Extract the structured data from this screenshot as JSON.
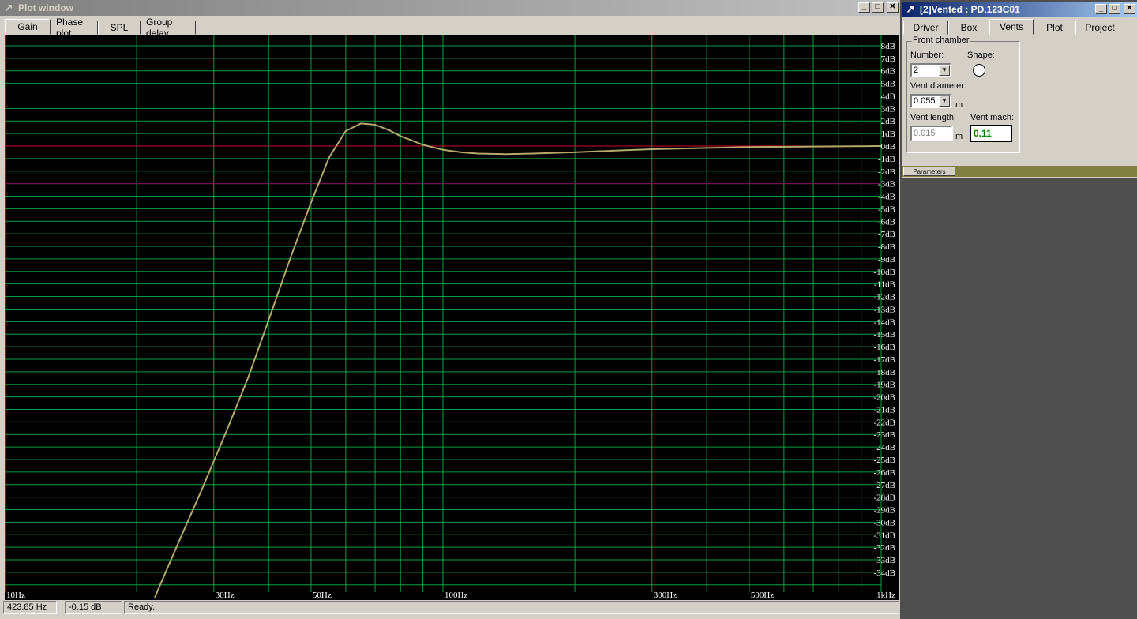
{
  "plot_window": {
    "title": "Plot window",
    "tabs": [
      {
        "label": "Gain",
        "active": true
      },
      {
        "label": "Phase plot",
        "active": false
      },
      {
        "label": "SPL",
        "active": false
      },
      {
        "label": "Group delay",
        "active": false
      }
    ]
  },
  "status": {
    "frequency": "423.85 Hz",
    "gain": "-0.15 dB",
    "message": "Ready.."
  },
  "vented_window": {
    "title": "[2]Vented : PD.123C01",
    "tabs": [
      {
        "label": "Driver",
        "active": false
      },
      {
        "label": "Box",
        "active": false
      },
      {
        "label": "Vents",
        "active": true
      },
      {
        "label": "Plot",
        "active": false
      },
      {
        "label": "Project",
        "active": false
      }
    ],
    "group_label": "Front chamber",
    "number_label": "Number:",
    "number_value": "2",
    "shape_label": "Shape:",
    "vent_diameter_label": "Vent diameter:",
    "vent_diameter_value": "0.055",
    "unit_m": "m",
    "vent_length_label": "Vent length:",
    "vent_length_value": "0.015",
    "vent_mach_label": "Vent mach:",
    "vent_mach_value": "0.11",
    "parameters_tab": "Parameters"
  },
  "colors": {
    "grid": "#00a040",
    "curve": "#b5a86a",
    "zero_line": "#d00030",
    "minus3_line": "#8a0060",
    "axis_text": "#ffffff",
    "mach_text": "#008000"
  },
  "chart_data": {
    "type": "line",
    "x_scale": "log",
    "xlim": [
      10,
      1000
    ],
    "ylim": [
      -36,
      9
    ],
    "x_tick_labels": [
      {
        "x": 10,
        "label": "10Hz"
      },
      {
        "x": 30,
        "label": "30Hz"
      },
      {
        "x": 50,
        "label": "50Hz"
      },
      {
        "x": 100,
        "label": "100Hz"
      },
      {
        "x": 300,
        "label": "300Hz"
      },
      {
        "x": 500,
        "label": "500Hz"
      },
      {
        "x": 1000,
        "label": "1kHz"
      }
    ],
    "y_ticks": [
      8,
      7,
      6,
      5,
      4,
      3,
      2,
      1,
      0,
      -1,
      -2,
      -3,
      -4,
      -5,
      -6,
      -7,
      -8,
      -9,
      -10,
      -11,
      -12,
      -13,
      -14,
      -15,
      -16,
      -17,
      -18,
      -19,
      -20,
      -21,
      -22,
      -23,
      -24,
      -25,
      -26,
      -27,
      -28,
      -29,
      -30,
      -31,
      -32,
      -33,
      -34
    ],
    "y_tick_suffix": "dB",
    "reference_lines": [
      0,
      -3
    ],
    "grid": true,
    "series": [
      {
        "x": [
          22,
          25,
          28,
          32,
          36,
          40,
          45,
          50,
          55,
          60,
          65,
          70,
          75,
          80,
          90,
          100,
          110,
          120,
          140,
          160,
          200,
          250,
          300,
          400,
          500,
          700,
          1000
        ],
        "y": [
          -36,
          -31.5,
          -27.6,
          -22.8,
          -18.4,
          -13.9,
          -8.8,
          -4.5,
          -0.9,
          1.2,
          1.8,
          1.7,
          1.3,
          0.8,
          0.1,
          -0.3,
          -0.5,
          -0.6,
          -0.65,
          -0.6,
          -0.5,
          -0.35,
          -0.25,
          -0.15,
          -0.08,
          -0.04,
          0
        ]
      }
    ]
  }
}
